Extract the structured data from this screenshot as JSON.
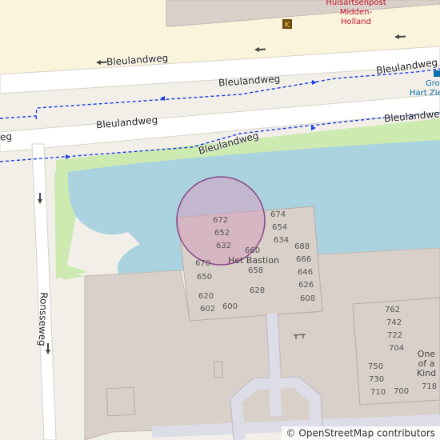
{
  "streets": {
    "bleulandweg_1": "Bleulandweg",
    "bleulandweg_2": "Bleulandweg",
    "bleulandweg_3": "Bleulandweg",
    "bleulandweg_4": "Bleulandweg",
    "bleulandweg_5": "Bleulandweg",
    "bleulandweg_6": "Bleulandweg",
    "bleulandweg_7": "eg",
    "ronsseweg": "Ronsseweg"
  },
  "poi": {
    "line1": "Huisartsenpost",
    "line2": "Midden-",
    "line3": "Holland"
  },
  "bus_stop": {
    "line1": "Gro",
    "line2": "Hart Zie"
  },
  "building_names": {
    "het_bastion": "Het Bastion",
    "one_of_a_kind_1": "One",
    "one_of_a_kind_2": "of a",
    "one_of_a_kind_3": "Kind"
  },
  "house_numbers": {
    "n672": "672",
    "n652": "652",
    "n632": "632",
    "n674": "674",
    "n654": "654",
    "n634": "634",
    "n688": "688",
    "n666": "666",
    "n646": "646",
    "n626": "626",
    "n608": "608",
    "n660": "660",
    "n658": "658",
    "n628": "628",
    "n670": "670",
    "n650": "650",
    "n620": "620",
    "n602": "602",
    "n600": "600",
    "n762": "762",
    "n742": "742",
    "n722": "722",
    "n704": "704",
    "n750": "750",
    "n730": "730",
    "n710": "710",
    "n700": "700",
    "n718": "718"
  },
  "attribution": {
    "symbol": "©",
    "text": "OpenStreetMap contributors"
  },
  "colors": {
    "water": "#aad3df",
    "grass": "#cdebb0",
    "building": "#d9d0c9",
    "road": "#ffffff",
    "footway": "#1a3de0",
    "highlight_fill": "#d6a0c0",
    "highlight_stroke": "#8a4d8a"
  },
  "icons": {
    "hospital": "hospital-icon",
    "bus_stop": "bus-stop-icon",
    "bench": "bench-icon"
  }
}
